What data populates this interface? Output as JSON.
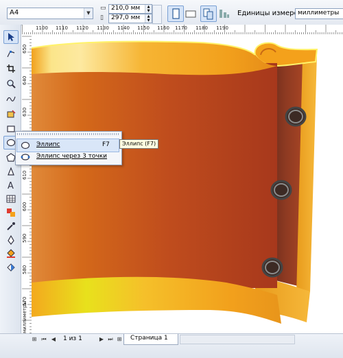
{
  "property_bar": {
    "page_size": "A4",
    "width": "210,0 мм",
    "height": "297,0 мм",
    "units_label": "Единицы измерения:",
    "units_value": "миллиметры"
  },
  "ruler_top": {
    "unit_corner": "%",
    "labels": [
      "1100",
      "1110",
      "1120",
      "1130",
      "1140",
      "1150",
      "1160",
      "1170",
      "1180",
      "1190"
    ]
  },
  "ruler_left": {
    "labels": [
      "650",
      "640",
      "630",
      "620",
      "610",
      "600",
      "590",
      "580",
      "570"
    ],
    "unit": "миллиметры"
  },
  "flyout": {
    "items": [
      {
        "label": "Эллипс",
        "shortcut": "F7"
      },
      {
        "label": "Эллипс через 3 точки",
        "shortcut": ""
      }
    ],
    "tooltip": "Эллипс (F7)"
  },
  "status": {
    "page_counter": "1 из 1",
    "page_tab": "Страница 1"
  },
  "colors": {
    "scroll_dark": "#b0401f",
    "scroll_mid": "#d4691a",
    "gold": "#f4a11b",
    "highlight": "#fff36a",
    "grommet": "#555555"
  }
}
